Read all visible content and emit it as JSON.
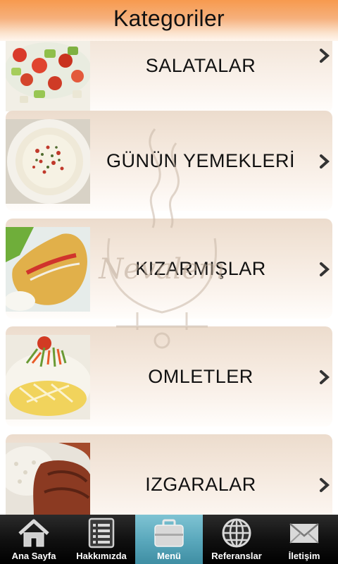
{
  "header": {
    "title": "Kategoriler"
  },
  "watermark": {
    "brand": "Nevalem"
  },
  "categories": [
    {
      "label": "SALATALAR",
      "image": "salad"
    },
    {
      "label": "GÜNÜN YEMEKLERİ",
      "image": "yogurt-dish"
    },
    {
      "label": "KIZARMIŞLAR",
      "image": "fried-cutlet"
    },
    {
      "label": "OMLETLER",
      "image": "omelette"
    },
    {
      "label": "IZGARALAR",
      "image": "grilled-meat"
    }
  ],
  "tabbar": {
    "active_index": 2,
    "active_color": "#5ba9bd",
    "tabs": [
      {
        "label": "Ana Sayfa",
        "icon": "home-icon"
      },
      {
        "label": "Hakkımızda",
        "icon": "list-icon"
      },
      {
        "label": "Menü",
        "icon": "briefcase-icon"
      },
      {
        "label": "Referanslar",
        "icon": "globe-icon"
      },
      {
        "label": "İletişim",
        "icon": "mail-icon"
      }
    ]
  },
  "colors": {
    "header_top": "#f79a4e",
    "header_bottom": "#fff6ee",
    "card": "#f3e6da",
    "tabbar": "#111111"
  }
}
